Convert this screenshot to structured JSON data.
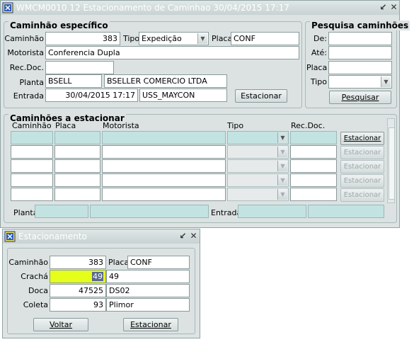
{
  "main_window": {
    "title": "WMCM0010.12    Estacionamento de Caminhao    30/04/2015 17:17",
    "specific": {
      "title": "Caminhão específico",
      "caminhao_label": "Caminhão",
      "caminhao_value": "383",
      "tipo_label": "Tipo",
      "tipo_value": "Expedição",
      "placa_label": "Placa",
      "placa_value": "CONF",
      "motorista_label": "Motorista",
      "motorista_value": "Conferencia Dupla",
      "recdoc_label": "Rec.Doc.",
      "recdoc_value": "",
      "planta_label": "Planta",
      "planta_code": "BSELL",
      "planta_name": "BSELLER COMERCIO LTDA",
      "entrada_label": "Entrada",
      "entrada_value": "30/04/2015 17:17",
      "entrada_user": "USS_MAYCON",
      "estacionar_label": "Estacionar"
    },
    "search": {
      "title": "Pesquisa caminhões",
      "de_label": "De:",
      "ate_label": "Até:",
      "placa_label": "Placa",
      "tipo_label": "Tipo",
      "pesquisar_label": "Pesquisar"
    },
    "list": {
      "title": "Caminhões a estacionar",
      "columns": [
        "Caminhão",
        "Placa",
        "Motorista",
        "Tipo",
        "Rec.Doc."
      ],
      "row_button_label": "Estacionar",
      "planta_label": "Planta",
      "entrada_label": "Entrada"
    }
  },
  "dialog": {
    "title": "Estacionamento",
    "caminhao_label": "Caminhão",
    "caminhao_value": "383",
    "placa_label": "Placa",
    "placa_value": "CONF",
    "cracha_label": "Crachá",
    "cracha_value": "49",
    "cracha_desc": "49",
    "doca_label": "Doca",
    "doca_value": "47525",
    "doca_desc": "DS02",
    "coleta_label": "Coleta",
    "coleta_value": "93",
    "coleta_desc": "Plimor",
    "voltar_label": "Voltar",
    "estacionar_label": "Estacionar"
  },
  "colors": {
    "title_text": "#ffffff",
    "panel_bg": "#dce2e2",
    "teal_field": "#c3e3e3",
    "highlight": "#e6ff1a"
  }
}
